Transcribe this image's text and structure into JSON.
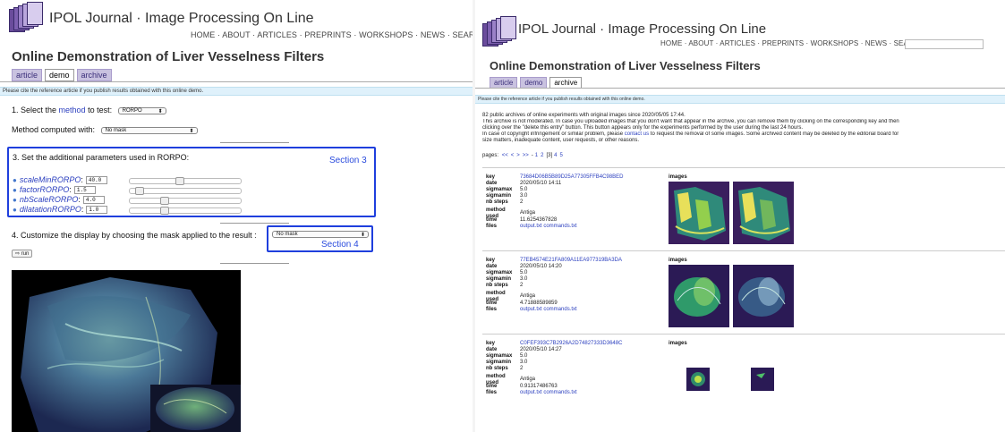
{
  "left": {
    "site_title": "IPOL Journal · Image Processing On Line",
    "nav": [
      "HOME",
      "ABOUT",
      "ARTICLES",
      "PREPRINTS",
      "WORKSHOPS",
      "NEWS",
      "SEARCH"
    ],
    "nav_sep": " · ",
    "page_title": "Online Demonstration of Liver Vesselness Filters",
    "tabs": [
      "article",
      "demo",
      "archive"
    ],
    "cite_notice": "Please cite the reference article if you publish results obtained with this online demo.",
    "step1_prefix": "1. Select the ",
    "step1_link": "method",
    "step1_suffix": " to test:",
    "method_value": "RORPO",
    "computed_with_label": "Method computed with:",
    "computed_with_value": "No mask",
    "step3_title": "3. Set the additional parameters used in RORPO:",
    "section3_label": "Section 3",
    "params": [
      {
        "name": "scaleMinRORPO",
        "value": "40.0",
        "level": 0.45
      },
      {
        "name": "factorRORPO",
        "value": "1.5",
        "level": 0.05
      },
      {
        "name": "nbScaleRORPO",
        "value": "4.0",
        "level": 0.3
      },
      {
        "name": "dilatationRORPO",
        "value": "1.0",
        "level": 0.3
      }
    ],
    "param_colon": ":",
    "step4_text": "4. Customize the display by choosing the mask applied to the result :",
    "mask_value": "No mask",
    "section4_label": "Section 4",
    "run_label": "run",
    "colors": {
      "highlight": "#1f3fdd",
      "tab_bg": "#c9c2e0",
      "link": "#2b3fbf"
    }
  },
  "right": {
    "site_title": "IPOL Journal · Image Processing On Line",
    "nav": [
      "HOME",
      "ABOUT",
      "ARTICLES",
      "PREPRINTS",
      "WORKSHOPS",
      "NEWS",
      "SEARCH"
    ],
    "nav_sep": " · ",
    "page_title": "Online Demonstration of Liver Vesselness Filters",
    "tabs": [
      "article",
      "demo",
      "archive"
    ],
    "cite_notice": "Please cite the reference article if you publish results obtained with this online demo.",
    "archive_line1": "82 public archives of online experiments with original images since 2020/05/05 17:44.",
    "archive_line2": "This archive is not moderated. In case you uploaded images that you don't want that appear in the archive, you can remove them by clicking on the corresponding key and then",
    "archive_line3": "clicking over the \"delete this entry\" button. This button appears only for the experiments performed by the user during the last 24 hours.",
    "archive_line4a": "In case of copyright infringement or similar problem, please ",
    "archive_line4_link": "contact us",
    "archive_line4b": " to request the removal of some images. Some archived content may be deleted by the editorial board for",
    "archive_line5": "size matters, inadequate content, user requests, or other reasons.",
    "pages_label": "pages:",
    "pages_nav": [
      "<<",
      "<",
      ">",
      ">>",
      "-",
      "1",
      "2",
      "[3]",
      "4",
      "5"
    ],
    "field_labels": {
      "key": "key",
      "date": "date",
      "sigmamax": "sigmamax",
      "sigmamin": "sigmamin",
      "nb_steps": "nb steps",
      "method_used": "method used",
      "time": "time",
      "files": "files",
      "images": "images"
    },
    "entries": [
      {
        "key": "73684D06B5B89D25A77305FFB4C98BED",
        "date": "2020/05/10 14:11",
        "sigmamax": "5.0",
        "sigmamin": "3.0",
        "nb_steps": "2",
        "method": "Antiga",
        "time": "11.6254367828",
        "files": "output.txt commands.txt"
      },
      {
        "key": "77EB4574E21FA809A11EA977319BA3DA",
        "date": "2020/05/10 14:20",
        "sigmamax": "5.0",
        "sigmamin": "3.0",
        "nb_steps": "2",
        "method": "Antiga",
        "time": "4.71888589859",
        "files": "output.txt commands.txt"
      },
      {
        "key": "C0FEF393C7B2926A2D74827333D3648C",
        "date": "2020/05/10 14:27",
        "sigmamax": "5.0",
        "sigmamin": "3.0",
        "nb_steps": "2",
        "method": "Antiga",
        "time": "0.91317486763",
        "files": "output.txt commands.txt"
      }
    ]
  }
}
